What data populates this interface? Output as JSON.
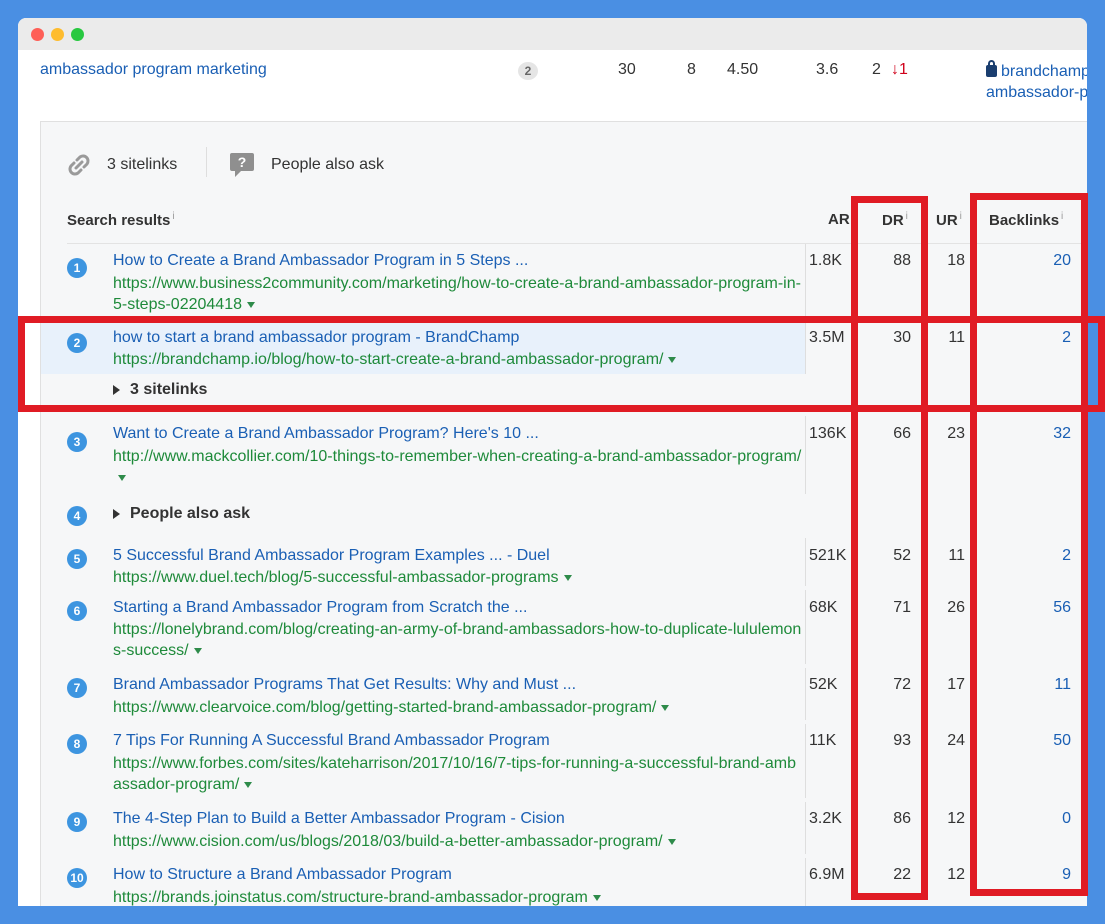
{
  "keyword_row": {
    "keyword": "ambassador program marketing",
    "badge": "2",
    "cols": [
      "30",
      "8",
      "4.50",
      "3.6",
      "2"
    ],
    "pos_change": "↓1",
    "url_line1": "brandchamp",
    "url_line2": "ambassador-p"
  },
  "features": {
    "sitelinks": "3 sitelinks",
    "people_also_ask": "People also ask"
  },
  "headers": {
    "search_results": "Search results",
    "ar": "AR",
    "dr": "DR",
    "ur": "UR",
    "backlinks": "Backlinks",
    "info": "i"
  },
  "results": [
    {
      "n": "1",
      "title": "How to Create a Brand Ambassador Program in 5 Steps ...",
      "url": "https://www.business2community.com/marketing/how-to-create-a-brand-ambassador-program-in-5-steps-02204418",
      "ar": "1.8K",
      "dr": "88",
      "ur": "18",
      "bl": "20"
    },
    {
      "n": "2",
      "title": "how to start a brand ambassador program - BrandChamp",
      "url": "https://brandchamp.io/blog/how-to-start-create-a-brand-ambassador-program/",
      "ar": "3.5M",
      "dr": "30",
      "ur": "11",
      "bl": "2",
      "expander": "3 sitelinks"
    },
    {
      "n": "3",
      "title": "Want to Create a Brand Ambassador Program? Here's 10 ...",
      "url": "http://www.mackcollier.com/10-things-to-remember-when-creating-a-brand-ambassador-program/",
      "ar": "136K",
      "dr": "66",
      "ur": "23",
      "bl": "32"
    },
    {
      "n": "4",
      "expander": "People also ask"
    },
    {
      "n": "5",
      "title": "5 Successful Brand Ambassador Program Examples ... - Duel",
      "url": "https://www.duel.tech/blog/5-successful-ambassador-programs",
      "ar": "521K",
      "dr": "52",
      "ur": "11",
      "bl": "2"
    },
    {
      "n": "6",
      "title": "Starting a Brand Ambassador Program from Scratch the ...",
      "url": "https://lonelybrand.com/blog/creating-an-army-of-brand-ambassadors-how-to-duplicate-lululemons-success/",
      "ar": "68K",
      "dr": "71",
      "ur": "26",
      "bl": "56"
    },
    {
      "n": "7",
      "title": "Brand Ambassador Programs That Get Results: Why and Must ...",
      "url": "https://www.clearvoice.com/blog/getting-started-brand-ambassador-program/",
      "ar": "52K",
      "dr": "72",
      "ur": "17",
      "bl": "11"
    },
    {
      "n": "8",
      "title": "7 Tips For Running A Successful Brand Ambassador Program",
      "url": "https://www.forbes.com/sites/kateharrison/2017/10/16/7-tips-for-running-a-successful-brand-ambassador-program/",
      "ar": "11K",
      "dr": "93",
      "ur": "24",
      "bl": "50"
    },
    {
      "n": "9",
      "title": "The 4-Step Plan to Build a Better Ambassador Program - Cision",
      "url": "https://www.cision.com/us/blogs/2018/03/build-a-better-ambassador-program/",
      "ar": "3.2K",
      "dr": "86",
      "ur": "12",
      "bl": "0"
    },
    {
      "n": "10",
      "title": "How to Structure a Brand Ambassador Program",
      "url": "https://brands.joinstatus.com/structure-brand-ambassador-program",
      "ar": "6.9M",
      "dr": "22",
      "ur": "12",
      "bl": "9"
    }
  ],
  "colors": {
    "background": "#4a8fe3",
    "link": "#1a5fb4",
    "url": "#1e8a3a",
    "highlight_box": "#e01b24",
    "rank_circle": "#3d95e0"
  }
}
